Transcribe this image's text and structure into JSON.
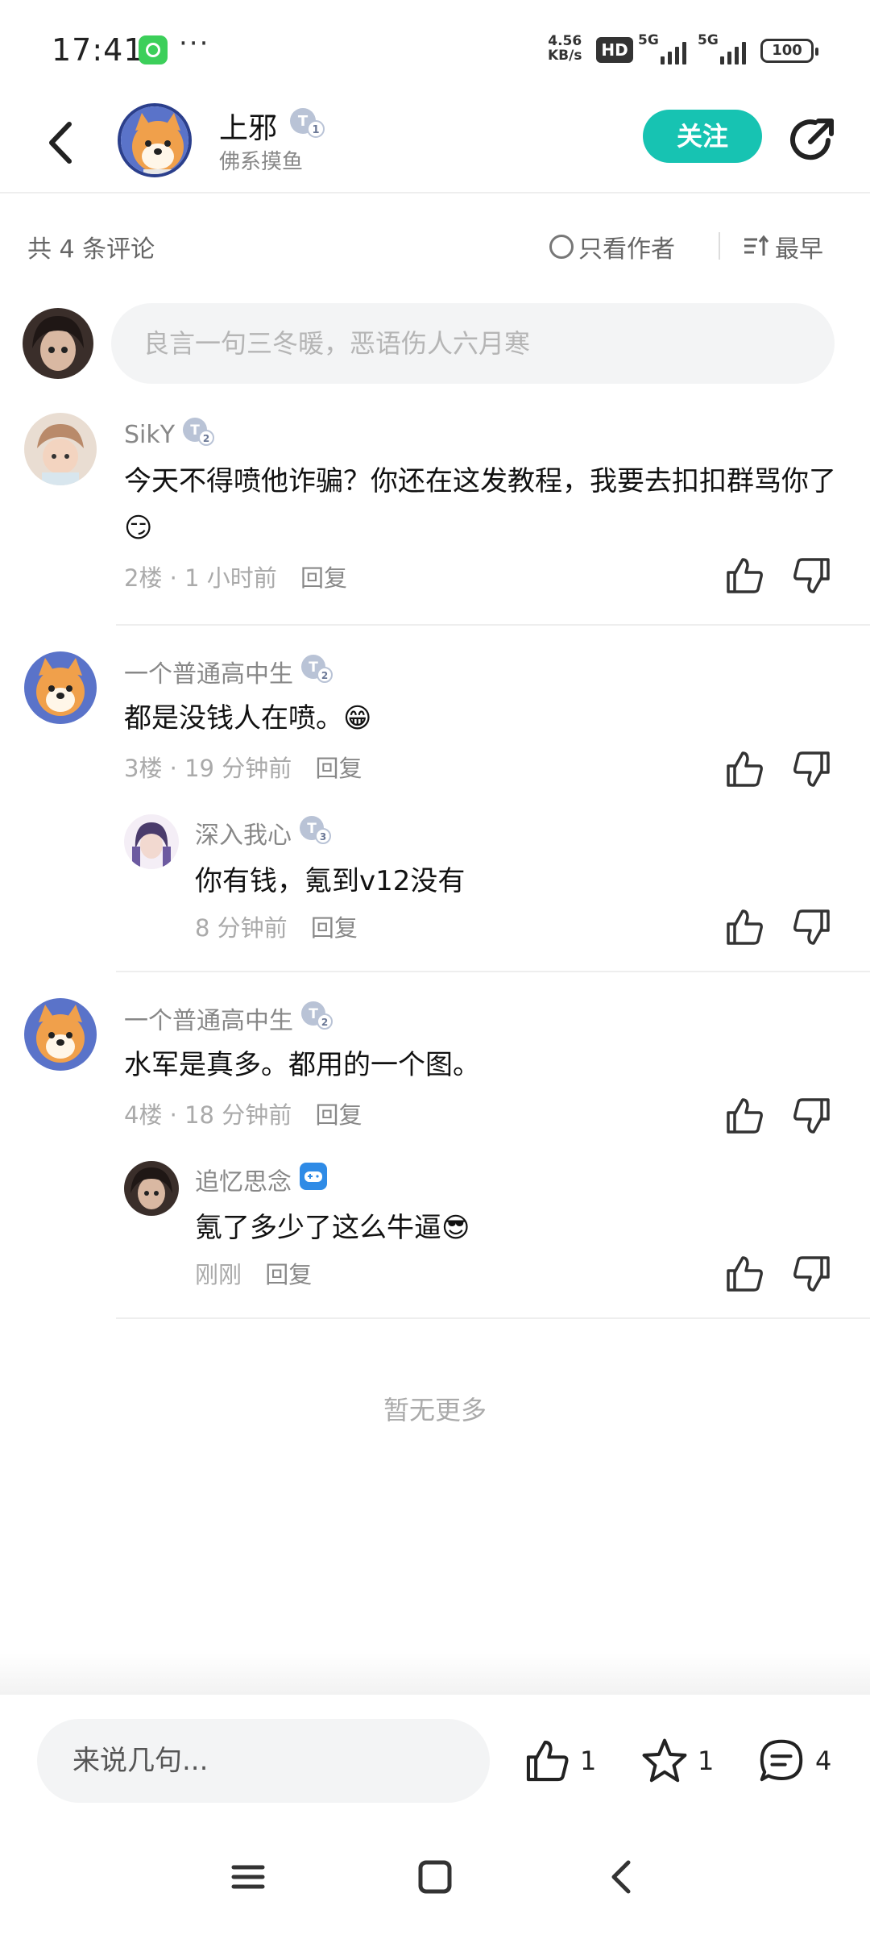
{
  "status_bar": {
    "time": "17:41",
    "more": "···",
    "speed_value": "4.56",
    "speed_unit": "KB/s",
    "hd": "HD",
    "net1": "5G",
    "net2": "5G",
    "battery": "100"
  },
  "header": {
    "author_name": "上邪",
    "author_subtitle": "佛系摸鱼",
    "follow_label": "关注",
    "author_level": "1"
  },
  "meta": {
    "comment_count": "共 4 条评论",
    "author_only": "只看作者",
    "sort": "最早"
  },
  "input": {
    "placeholder": "良言一句三冬暖，恶语伤人六月寒"
  },
  "comments": [
    {
      "name": "SikY",
      "level": "2",
      "text": "今天不得喷他诈骗？你还在这发教程，我要去扣扣群骂你了",
      "emoji": "😏",
      "floor": "2楼",
      "time": "1 小时前",
      "reply": "回复"
    },
    {
      "name": "一个普通高中生",
      "level": "2",
      "text": "都是没钱人在喷。",
      "emoji": "😁",
      "floor": "3楼",
      "time": "19 分钟前",
      "reply": "回复",
      "replies": [
        {
          "name": "深入我心",
          "level": "3",
          "text": "你有钱，氪到v12没有",
          "time": "8 分钟前",
          "reply": "回复"
        }
      ]
    },
    {
      "name": "一个普通高中生",
      "level": "2",
      "text": "水军是真多。都用的一个图。",
      "floor": "4楼",
      "time": "18 分钟前",
      "reply": "回复",
      "replies": [
        {
          "name": "追忆思念",
          "text": "氪了多少了这么牛逼",
          "emoji": "😎",
          "time": "刚刚",
          "reply": "回复"
        }
      ]
    }
  ],
  "no_more": "暂无更多",
  "bottom_bar": {
    "input_placeholder": "来说几句...",
    "likes": "1",
    "favorites": "1",
    "comments": "4"
  },
  "colors": {
    "accent": "#17c3b2",
    "text": "#111111",
    "secondary": "#888888",
    "input_bg": "#f3f4f5"
  }
}
